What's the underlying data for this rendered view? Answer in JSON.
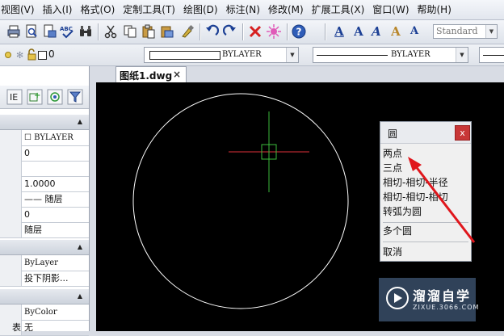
{
  "menu": [
    {
      "label": "视图(V)"
    },
    {
      "label": "插入(I)"
    },
    {
      "label": "格式(O)"
    },
    {
      "label": "定制工具(T)"
    },
    {
      "label": "绘图(D)"
    },
    {
      "label": "标注(N)"
    },
    {
      "label": "修改(M)"
    },
    {
      "label": "扩展工具(X)"
    },
    {
      "label": "窗口(W)"
    },
    {
      "label": "帮助(H)"
    }
  ],
  "toolbar": {
    "icons": [
      "print-icon",
      "print-preview-icon",
      "publish-icon",
      "spell-check-icon",
      "find-icon",
      "cut-icon",
      "copy-icon",
      "paste-icon",
      "paste-special-icon",
      "match-properties-icon",
      "undo-icon",
      "redo-icon",
      "delete-icon",
      "explode-icon",
      "help-icon",
      "text-style-icon",
      "multiline-text-icon",
      "edit-text-icon",
      "text-find-icon",
      "text-scale-icon"
    ],
    "text_letters": [
      "A",
      "A",
      "A",
      "A",
      "A"
    ],
    "text_style_value": "Standard"
  },
  "property_bar": {
    "layer_value": "0",
    "color_value": "BYLAYER",
    "linetype_value": "BYLAYER"
  },
  "properties_panel": {
    "general_rows": [
      {
        "label": "",
        "value": "☐ BYLAYER"
      },
      {
        "label": "",
        "value": "0"
      },
      {
        "label": "",
        "value": ""
      },
      {
        "label": "",
        "value": "1.0000"
      },
      {
        "label": "",
        "value": "—— 随层"
      },
      {
        "label": "",
        "value": "0"
      },
      {
        "label": "",
        "value": "随层"
      }
    ],
    "view_rows": [
      {
        "label": "",
        "value": "ByLayer"
      },
      {
        "label": "",
        "value": "投下阴影..."
      }
    ],
    "misc_rows": [
      {
        "label": "",
        "value": "ByColor"
      },
      {
        "label": "表",
        "value": "无"
      }
    ]
  },
  "tab": {
    "label": "图纸1.dwg",
    "close": "×"
  },
  "circle_menu": {
    "title": "圆",
    "close": "x",
    "items": [
      "两点",
      "三点",
      "相切-相切-半径",
      "相切-相切-相切",
      "转弧为圆"
    ],
    "items2": [
      "多个圆"
    ],
    "items3": [
      "取消"
    ]
  },
  "watermark": {
    "main": "溜溜自学",
    "sub": "ZIXUE.3066.COM"
  },
  "colors": {
    "canvas": "#000000",
    "circle": "#ffffff",
    "crosshair_x": "#e0303a",
    "crosshair_y": "#3cbc3c",
    "annotation_arrow": "#e0161c",
    "close_button": "#c83737"
  }
}
